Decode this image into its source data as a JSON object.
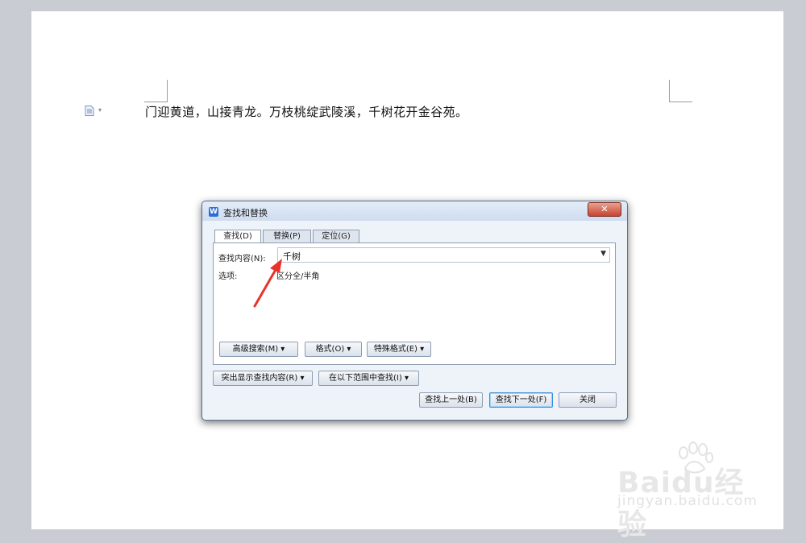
{
  "document": {
    "body_text": "门迎黄道，山接青龙。万枝桃绽武陵溪，千树花开金谷苑。"
  },
  "dialog": {
    "title": "查找和替换",
    "close_label": "✕",
    "tabs": [
      {
        "label": "查找(D)",
        "active": true
      },
      {
        "label": "替换(P)",
        "active": false
      },
      {
        "label": "定位(G)",
        "active": false
      }
    ],
    "find_label": "查找内容(N):",
    "find_value": "千树",
    "options_label": "选项:",
    "options_value": "区分全/半角",
    "advanced_search_label": "高级搜索(M) ▾",
    "format_label": "格式(O) ▾",
    "special_format_label": "特殊格式(E) ▾",
    "highlight_label": "突出显示查找内容(R) ▾",
    "range_label": "在以下范围中查找(I) ▾",
    "find_prev_label": "查找上一处(B)",
    "find_next_label": "查找下一处(F)",
    "close_button_label": "关闭"
  },
  "watermark": {
    "main": "Baidu经验",
    "sub": "jingyan.baidu.com"
  }
}
